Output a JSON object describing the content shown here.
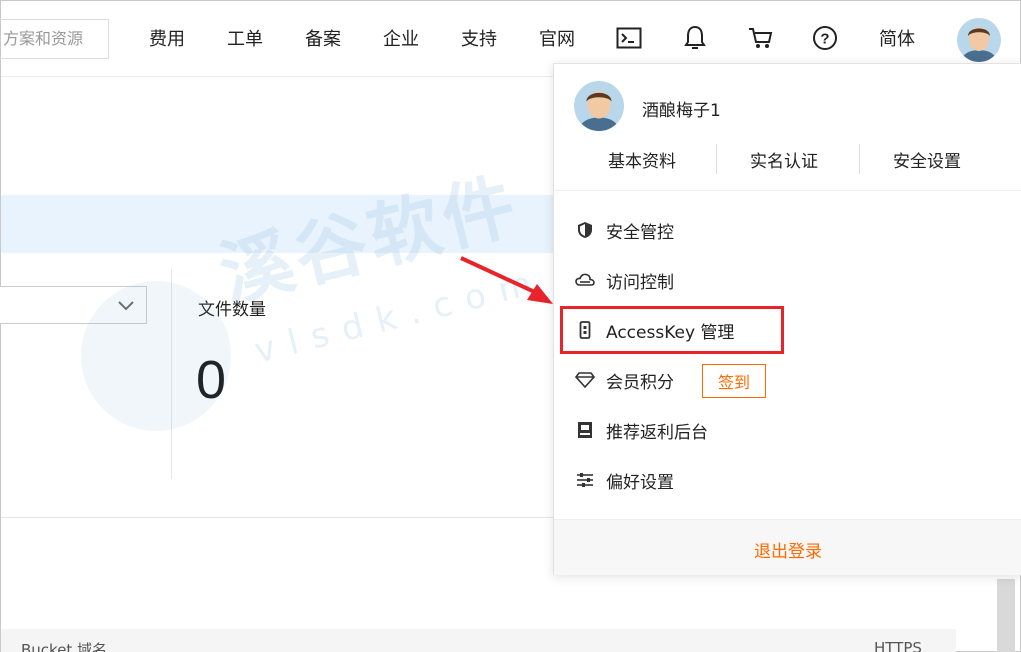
{
  "header": {
    "search_text": "方案和资源",
    "nav": [
      "费用",
      "工单",
      "备案",
      "企业",
      "支持",
      "官网"
    ],
    "lang_label": "简体",
    "icons": [
      "terminal-icon",
      "bell-icon",
      "cart-icon",
      "help-icon"
    ]
  },
  "main": {
    "metric_label": "文件数量",
    "metric_value": "0",
    "table_col_left": "Bucket 域名",
    "table_col_right": "HTTPS"
  },
  "watermark": {
    "text": "溪谷软件",
    "sub": "vlsdk.com"
  },
  "dropdown": {
    "username": "酒酿梅子1",
    "links": [
      "基本资料",
      "实名认证",
      "安全设置"
    ],
    "items": [
      {
        "label": "安全管控",
        "icon": "shield-icon"
      },
      {
        "label": "访问控制",
        "icon": "cloud-icon"
      },
      {
        "label": "AccessKey 管理",
        "icon": "key-icon"
      },
      {
        "label": "会员积分",
        "icon": "diamond-icon"
      },
      {
        "label": "推荐返利后台",
        "icon": "recommend-icon"
      },
      {
        "label": "偏好设置",
        "icon": "sliders-icon"
      }
    ],
    "checkin_label": "签到",
    "logout_label": "退出登录"
  },
  "colors": {
    "accent": "#ff6a00",
    "highlight": "#e8232a",
    "band": "#e9f3fd"
  }
}
